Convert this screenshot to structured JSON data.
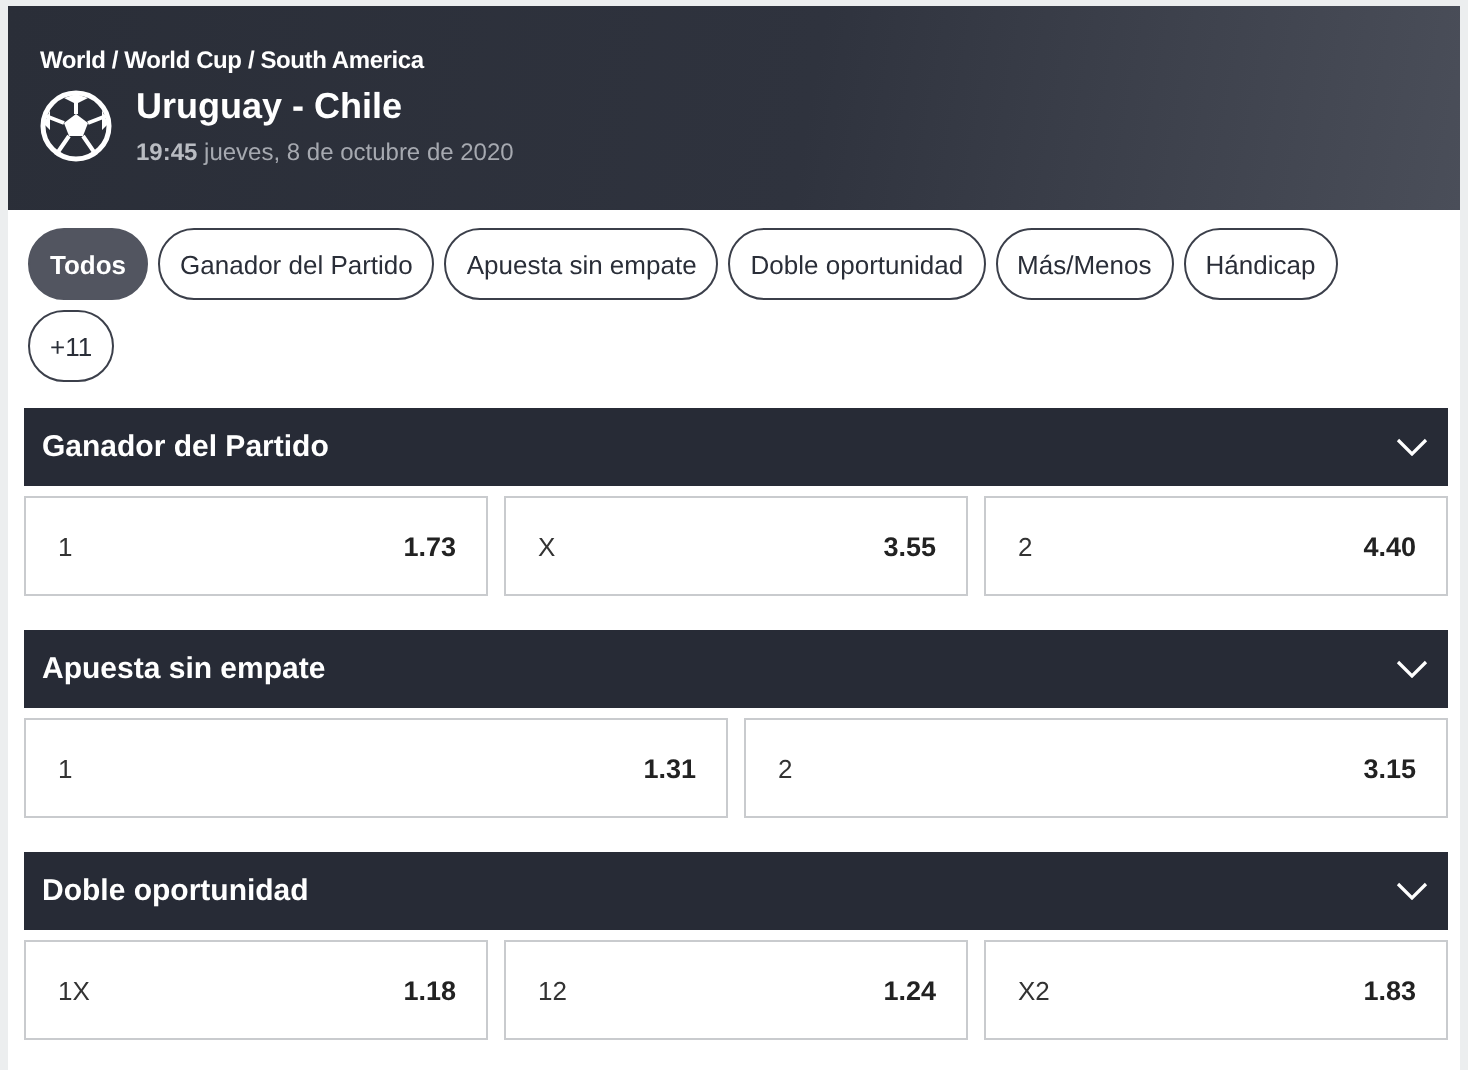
{
  "event": {
    "breadcrumb": "World / World Cup / South America",
    "title": "Uruguay - Chile",
    "time": "19:45",
    "date": "jueves, 8 de octubre de 2020"
  },
  "filters": [
    {
      "label": "Todos",
      "selected": true
    },
    {
      "label": "Ganador del Partido",
      "selected": false
    },
    {
      "label": "Apuesta sin empate",
      "selected": false
    },
    {
      "label": "Doble oportunidad",
      "selected": false
    },
    {
      "label": "Más/Menos",
      "selected": false
    },
    {
      "label": "Hándicap",
      "selected": false
    },
    {
      "label": "+11",
      "selected": false
    }
  ],
  "markets": [
    {
      "title": "Ganador del Partido",
      "expanded": true,
      "outcomes": [
        {
          "label": "1",
          "odds": "1.73"
        },
        {
          "label": "X",
          "odds": "3.55"
        },
        {
          "label": "2",
          "odds": "4.40"
        }
      ]
    },
    {
      "title": "Apuesta sin empate",
      "expanded": true,
      "outcomes": [
        {
          "label": "1",
          "odds": "1.31"
        },
        {
          "label": "2",
          "odds": "3.15"
        }
      ]
    },
    {
      "title": "Doble oportunidad",
      "expanded": true,
      "outcomes": [
        {
          "label": "1X",
          "odds": "1.18"
        },
        {
          "label": "12",
          "odds": "1.24"
        },
        {
          "label": "X2",
          "odds": "1.83"
        }
      ]
    }
  ]
}
